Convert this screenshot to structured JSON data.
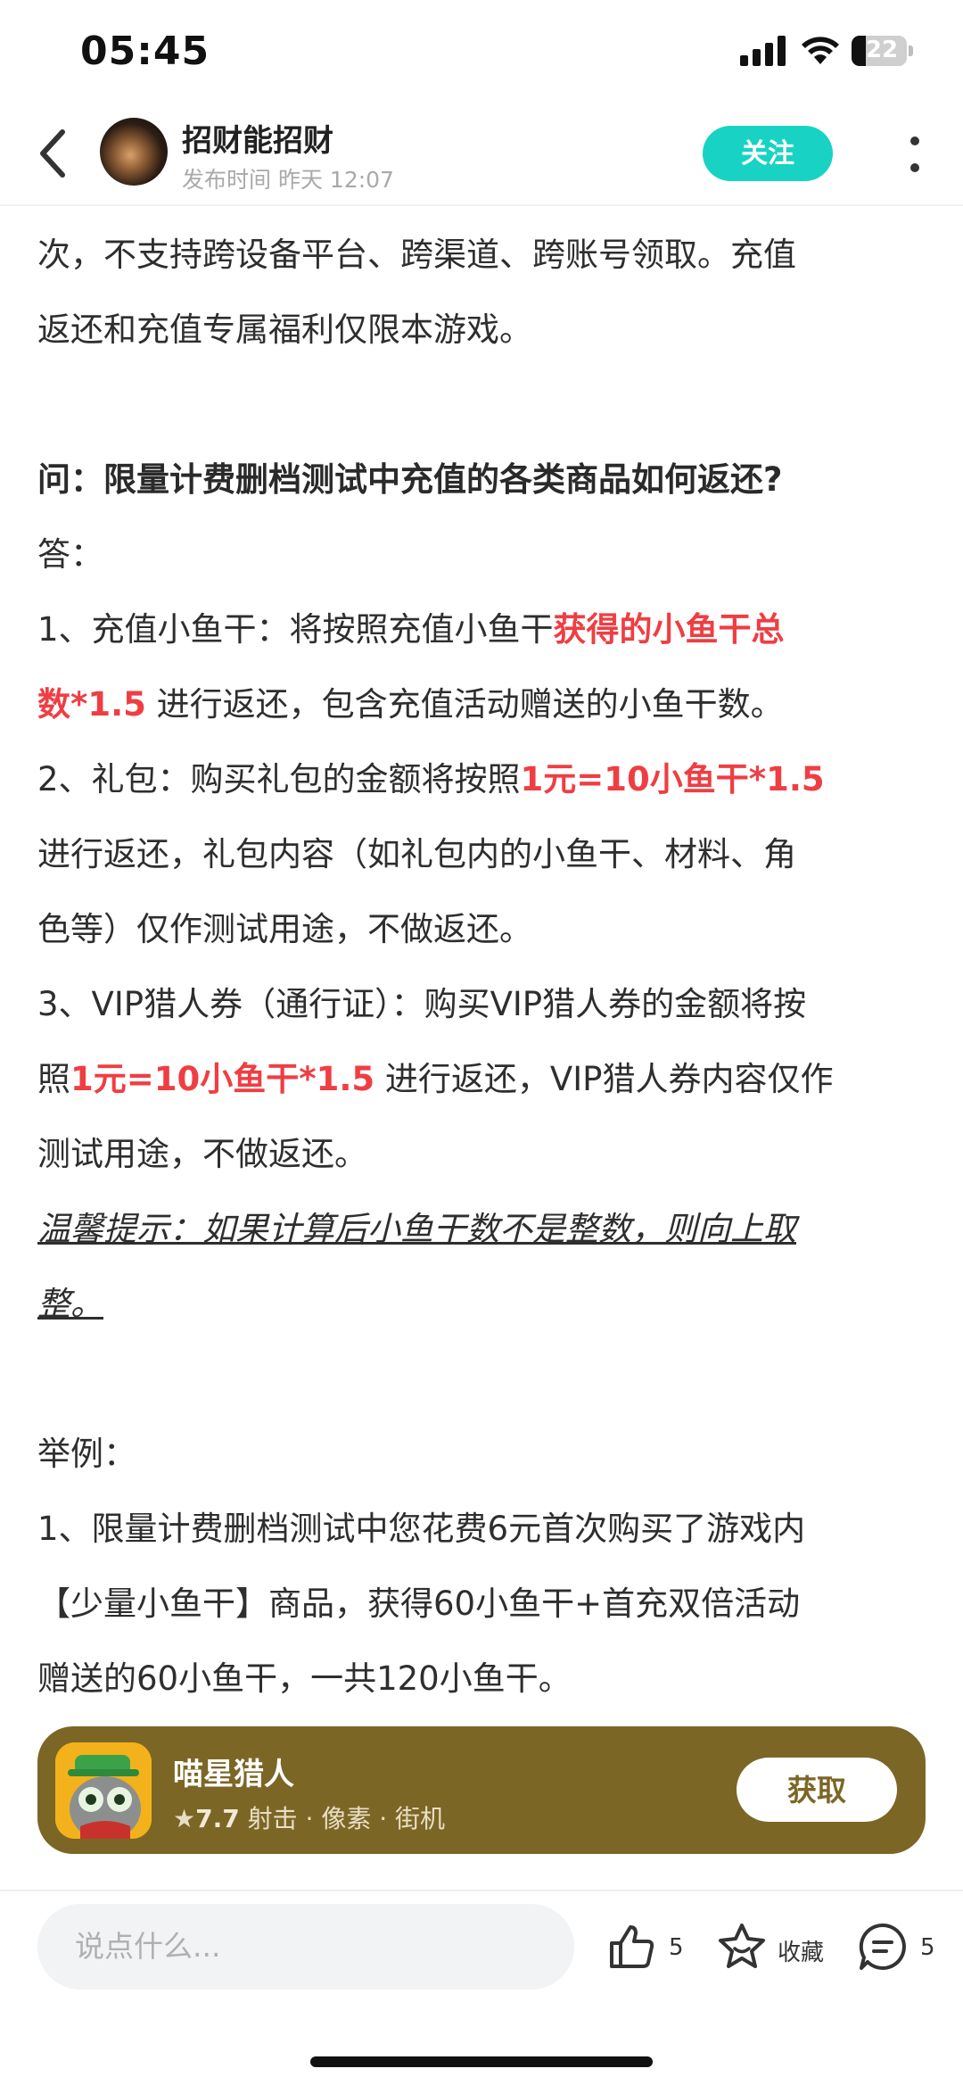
{
  "status_bar": {
    "time": "05:45",
    "battery": "22"
  },
  "header": {
    "author": "招财能招财",
    "publish_label": "发布时间",
    "publish_time": "昨天 12:07",
    "follow_label": "关注"
  },
  "article": {
    "p1_a": "次，不支持跨设备平台、跨渠道、跨账号领取。充值",
    "p1_b": "返还和充值专属福利仅限本游戏。",
    "question": "问：限量计费删档测试中充值的各类商品如何返还?",
    "answer": "答：",
    "item1_a": "1、充值小鱼干：将按照充值小鱼干",
    "item1_red_a": "获得的小鱼干总",
    "item1_red_b": "数*1.5",
    "item1_b": "进行返还，包含充值活动赠送的小鱼干数。",
    "item2_a": "2、礼包：购买礼包的金额将按照",
    "item2_red": "1元=10小鱼干*1.5",
    "item2_b": "进行返还，礼包内容（如礼包内的小鱼干、材料、角",
    "item2_c": "色等）仅作测试用途，不做返还。",
    "item3_a": "3、VIP猎人券（通行证）：购买VIP猎人券的金额将按",
    "item3_b": "照",
    "item3_red": "1元=10小鱼干*1.5",
    "item3_c": "进行返还，VIP猎人券内容仅作",
    "item3_d": "测试用途，不做返还。",
    "tip_a": "温馨提示：如果计算后小鱼干数不是整数，则向上取",
    "tip_b": "整。",
    "example_title": "举例：",
    "ex1_a": "1、限量计费删档测试中您花费6元首次购买了游戏内",
    "ex1_b": "【少量小鱼干】商品，获得60小鱼干+首充双倍活动",
    "ex1_c": "赠送的60小鱼干，一共120小鱼干。"
  },
  "game_card": {
    "name": "喵星猎人",
    "rating": "7.7",
    "tags": "射击 · 像素 · 街机",
    "get_label": "获取"
  },
  "bottom_bar": {
    "comment_placeholder": "说点什么...",
    "like_count": "5",
    "collect_label": "收藏",
    "comment_count": "5"
  }
}
